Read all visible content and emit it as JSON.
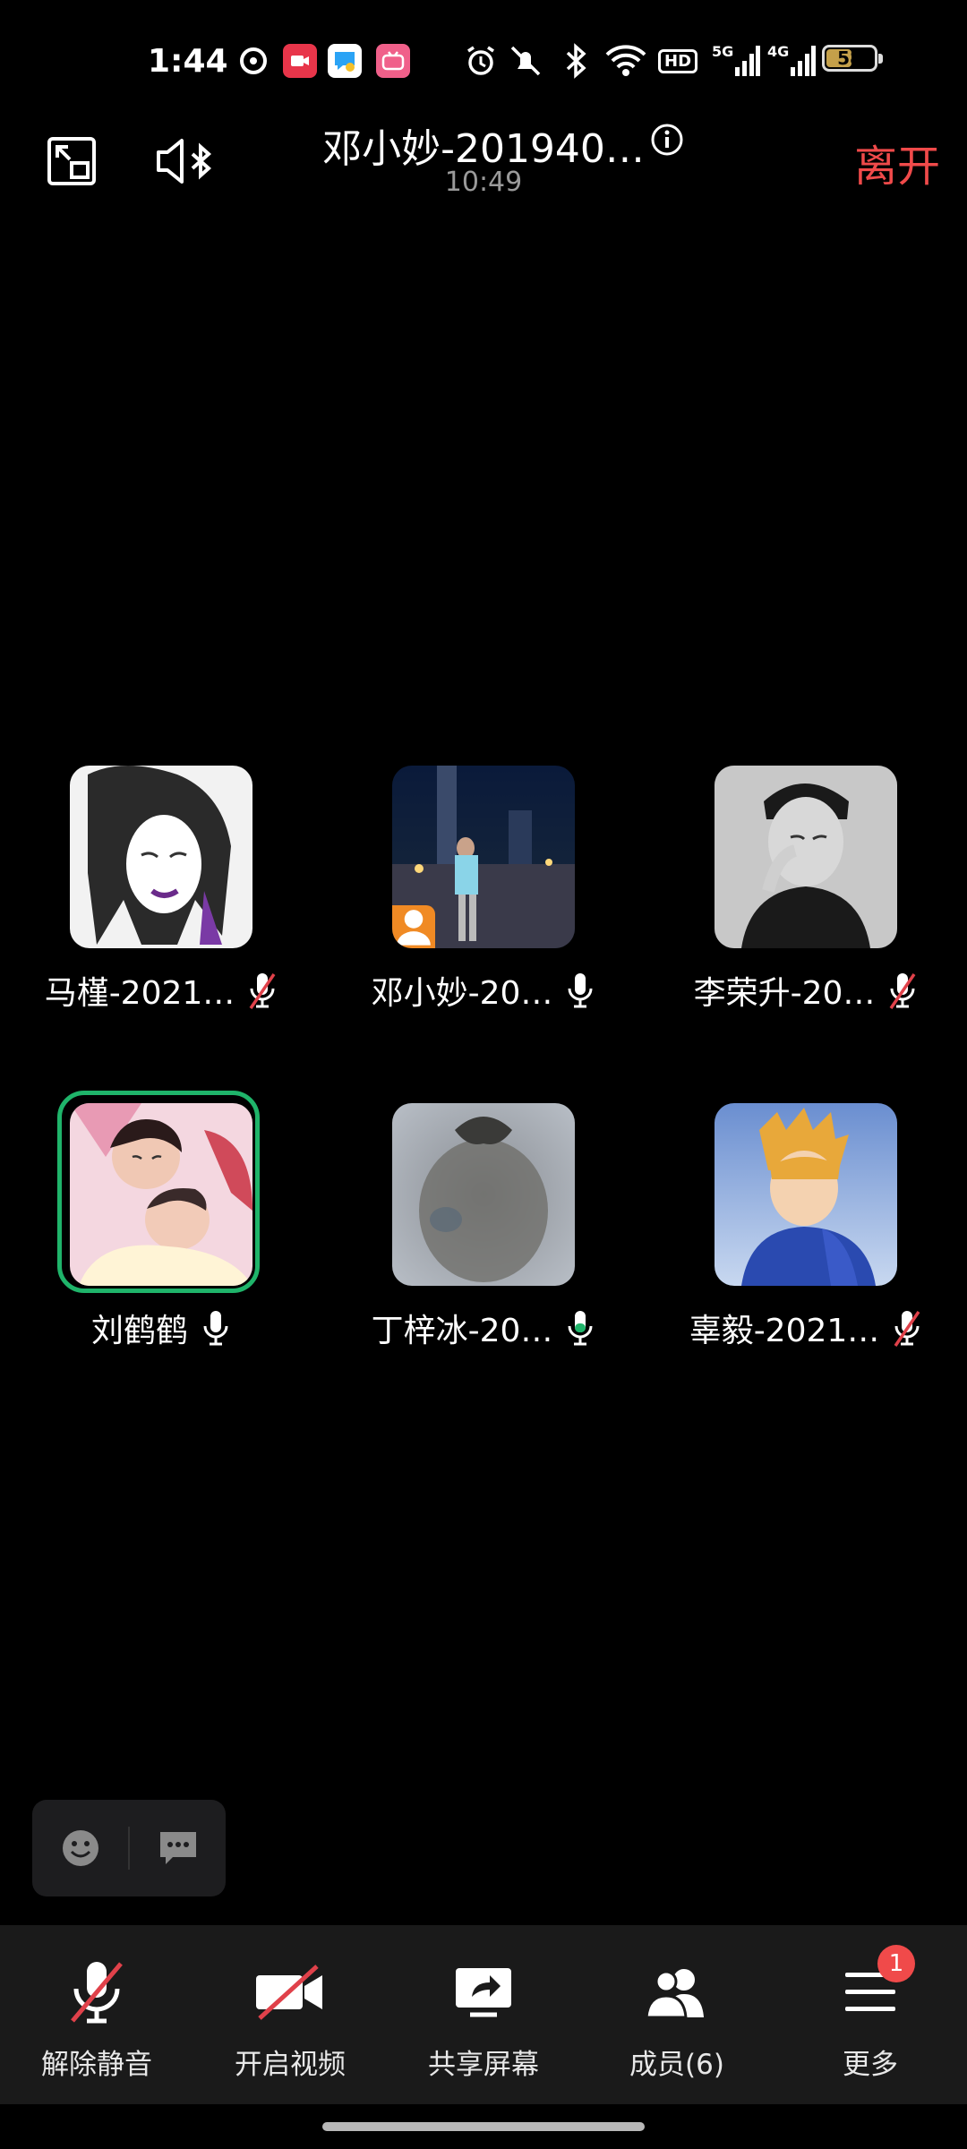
{
  "status_bar": {
    "time": "1:44",
    "network_labels": [
      "HD",
      "5G",
      "4G"
    ],
    "battery": "58",
    "battery_fraction": 0.58
  },
  "header": {
    "title": "邓小妙-201940…",
    "timer": "10:49",
    "leave_label": "离开"
  },
  "participants": [
    {
      "name": "马槿-2021…",
      "mic": "muted"
    },
    {
      "name": "邓小妙-20…",
      "mic": "on",
      "host": true
    },
    {
      "name": "李荣升-20…",
      "mic": "muted"
    },
    {
      "name": "刘鹤鹤",
      "mic": "on",
      "speaking": true
    },
    {
      "name": "丁梓冰-20…",
      "mic": "on-active"
    },
    {
      "name": "辜毅-2021…",
      "mic": "muted"
    }
  ],
  "toolbar": {
    "unmute_label": "解除静音",
    "video_label": "开启视频",
    "share_label": "共享屏幕",
    "members_label": "成员(6)",
    "more_label": "更多",
    "more_badge": "1"
  },
  "colors": {
    "leave": "#f04a4a",
    "speaking_ring": "#1fb46a",
    "host_badge": "#f08a24",
    "toolbar_bg": "#1a1a1a"
  }
}
